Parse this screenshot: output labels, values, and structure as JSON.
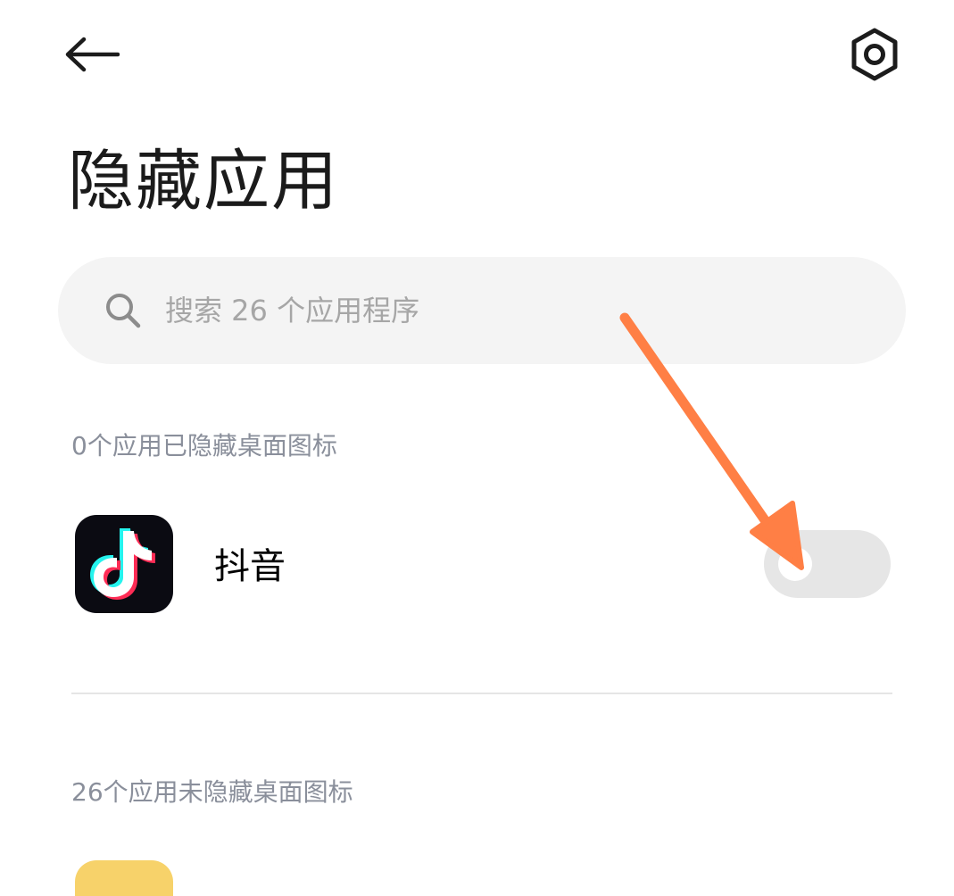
{
  "header": {
    "back_icon": "arrow-left-icon",
    "settings_icon": "hexagon-gear-icon"
  },
  "page": {
    "title": "隐藏应用"
  },
  "search": {
    "placeholder": "搜索 26 个应用程序",
    "value": "",
    "icon": "search-icon"
  },
  "sections": {
    "hidden_header": "0个应用已隐藏桌面图标",
    "visible_header": "26个应用未隐藏桌面图标"
  },
  "apps": [
    {
      "name": "抖音",
      "icon": "douyin-icon",
      "hidden": false
    }
  ],
  "colors": {
    "annotation_arrow": "#ff7f45",
    "toggle_off": "#e6e6e6",
    "search_bg": "#f4f4f4",
    "section_text": "#8a8f9b"
  }
}
